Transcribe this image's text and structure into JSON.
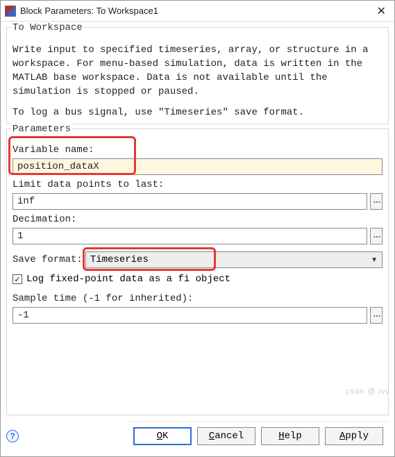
{
  "window": {
    "title": "Block Parameters: To Workspace1"
  },
  "section": {
    "legend": "To Workspace",
    "desc_line1": "Write input to specified timeseries, array, or structure in a workspace. For menu-based simulation, data is written in the MATLAB base workspace. Data is not available until the simulation is stopped or paused.",
    "desc_line2": "To log a bus signal, use \"Timeseries\" save format."
  },
  "params": {
    "legend": "Parameters",
    "variable_name_label": "Variable name:",
    "variable_name_value": "position_dataX",
    "limit_label": "Limit data points to last:",
    "limit_value": "inf",
    "decimation_label": "Decimation:",
    "decimation_value": "1",
    "save_format_label": "Save format:",
    "save_format_value": "Timeseries",
    "log_fi_label": "Log fixed-point data as a fi object",
    "log_fi_checked": true,
    "sample_time_label": "Sample time (-1 for inherited):",
    "sample_time_value": "-1"
  },
  "buttons": {
    "ok": "OK",
    "cancel": "Cancel",
    "help": "Help",
    "apply": "Apply"
  },
  "watermark": "csdn @ lvv"
}
